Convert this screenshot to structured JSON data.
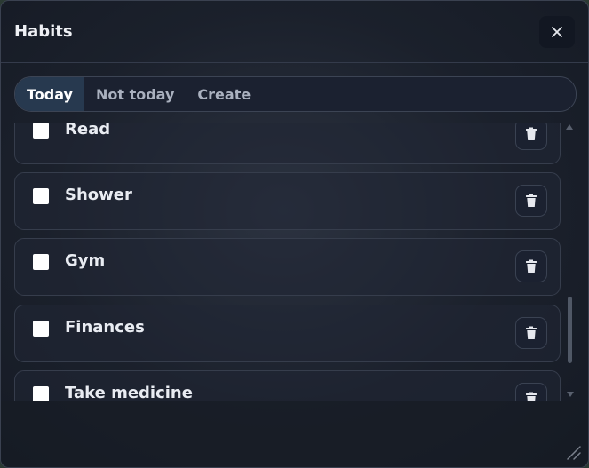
{
  "window": {
    "title": "Habits",
    "close_icon": "close-icon"
  },
  "tabs": [
    {
      "label": "Today",
      "active": true
    },
    {
      "label": "Not today",
      "active": false
    },
    {
      "label": "Create",
      "active": false
    }
  ],
  "habits": [
    {
      "label": "Read",
      "checked": false
    },
    {
      "label": "Shower",
      "checked": false
    },
    {
      "label": "Gym",
      "checked": false
    },
    {
      "label": "Finances",
      "checked": false
    },
    {
      "label": "Take medicine",
      "checked": false
    }
  ],
  "colors": {
    "background": "#1b2130",
    "active_tab": "#27394f",
    "text": "#e9ecf2",
    "muted_text": "#aab1bf"
  },
  "icons": {
    "delete": "trash-icon",
    "scroll_up": "chevron-up-icon",
    "scroll_down": "chevron-down-icon",
    "resize": "resize-grip-icon"
  }
}
